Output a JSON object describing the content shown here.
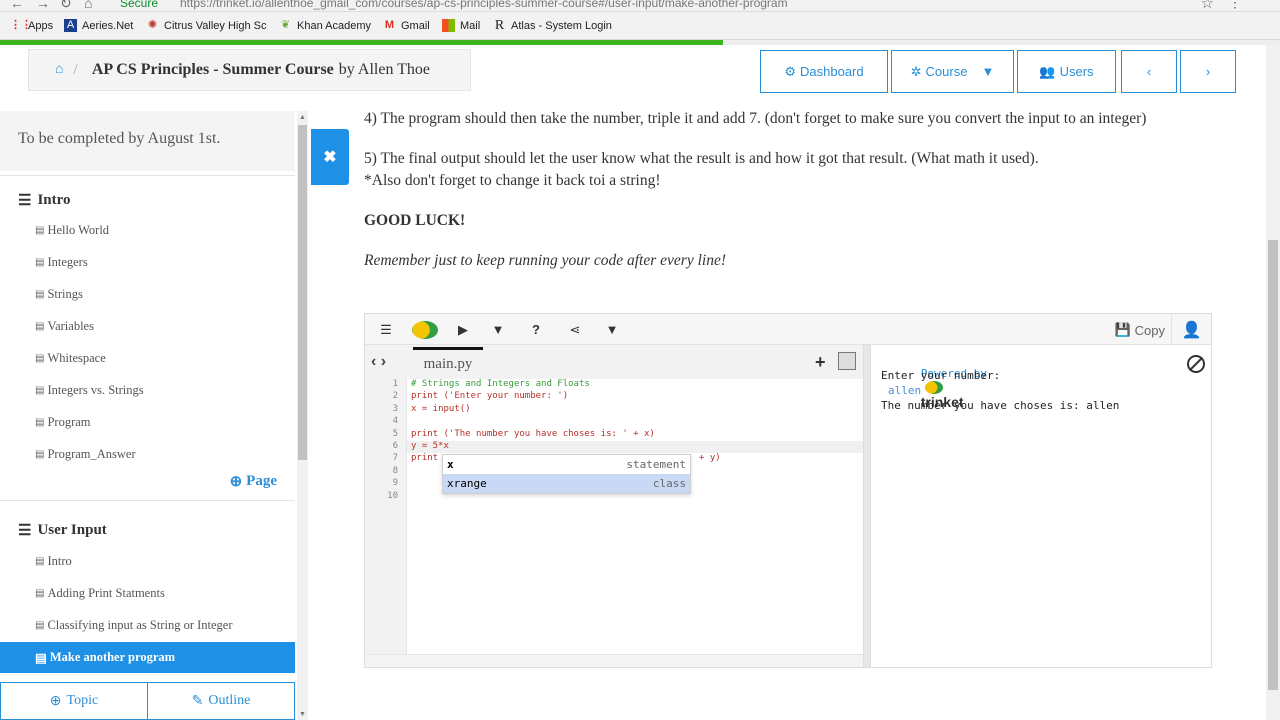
{
  "browser": {
    "secure_label": "Secure",
    "url": "https://trinket.io/allenthoe_gmail_com/courses/ap-cs-principles-summer-course#/user-input/make-another-program",
    "back_icon": "back-arrow-icon",
    "forward_icon": "forward-arrow-icon",
    "reload_icon": "reload-icon",
    "home_icon": "home-icon"
  },
  "bookmarks": [
    {
      "label": "Apps",
      "icon": "apps-grid-icon"
    },
    {
      "label": "Aeries.Net",
      "icon": "aeries-icon"
    },
    {
      "label": "Citrus Valley High Sc",
      "icon": "citrus-icon"
    },
    {
      "label": "Khan Academy",
      "icon": "khan-leaf-icon"
    },
    {
      "label": "Gmail",
      "icon": "gmail-icon"
    },
    {
      "label": "Mail",
      "icon": "mail-icon"
    },
    {
      "label": "Atlas - System Login",
      "icon": "atlas-icon"
    }
  ],
  "progress": {
    "percent": 56.5,
    "color": "#3cb521"
  },
  "breadcrumb": {
    "course_title": "AP CS Principles - Summer Course",
    "by_text": "by Allen Thoe"
  },
  "topnav": {
    "dashboard_label": "Dashboard",
    "course_label": "Course",
    "users_label": "Users",
    "prev_label": "‹",
    "next_label": "›"
  },
  "sidebar": {
    "note": "To be completed by August 1st.",
    "section1": {
      "title": "Intro",
      "items": [
        "Hello World",
        "Integers",
        "Strings",
        "Variables",
        "Whitespace",
        "Integers vs. Strings",
        "Program",
        "Program_Answer"
      ]
    },
    "add_page_label": "Page",
    "section2": {
      "title": "User Input",
      "items": [
        "Intro",
        "Adding Print Statments",
        "Classifying input as String or Integer"
      ],
      "active_item": "Make another program"
    },
    "topic_label": "Topic",
    "outline_label": "Outline"
  },
  "content": {
    "step4": "4) The program should then take the number, triple it and add 7. (don't forget to make sure you convert the input to an integer)",
    "step5_a": "5) The final output should let the user know what the result is and how it got that result. (What math it used).",
    "step5_b": "*Also don't forget to change it back toi a string!",
    "good_luck": "GOOD LUCK!",
    "reminder": "Remember just to keep running your code after every line!"
  },
  "trinket": {
    "copy_label": "Copy",
    "tab_name": "main.py",
    "code_lines": [
      {
        "n": "1",
        "text": "# Strings and Integers and Floats",
        "color": "#3a9a3a"
      },
      {
        "n": "2",
        "text": "print ('Enter your number: ')",
        "color": "#b5312a"
      },
      {
        "n": "3",
        "text": "x = input()",
        "color": "#b5312a"
      },
      {
        "n": "4",
        "text": "",
        "color": "#333"
      },
      {
        "n": "5",
        "text": "print ('The number you have choses is: ' + x)",
        "color": "#b5312a"
      },
      {
        "n": "6",
        "text": "y = 5*x",
        "color": "#b5312a"
      },
      {
        "n": "7",
        "text": "print",
        "color": "#b5312a"
      },
      {
        "n": "8",
        "text": "",
        "color": "#333"
      },
      {
        "n": "9",
        "text": "",
        "color": "#333"
      },
      {
        "n": "10",
        "text": "",
        "color": "#333"
      }
    ],
    "line7_tail": "+ y)",
    "autocomplete": [
      {
        "name": "x",
        "kind": "statement"
      },
      {
        "name": "xrange",
        "kind": "class"
      }
    ],
    "output": {
      "powered_by": "Powered by",
      "brand": "trinket",
      "line1": "Enter your number:",
      "input_echo": "allen",
      "line2": "The number you have choses is: allen"
    }
  },
  "colors": {
    "accent": "#1e90e6",
    "brand_green": "#3cb521"
  }
}
